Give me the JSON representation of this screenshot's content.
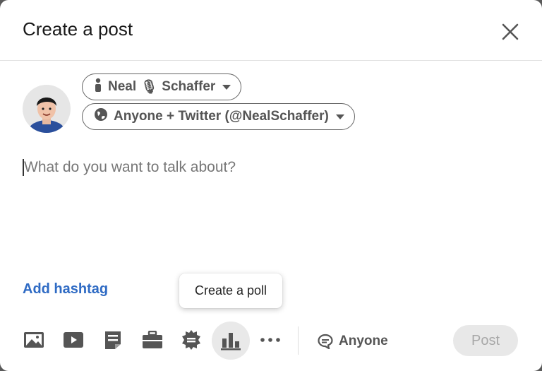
{
  "dialog": {
    "title": "Create a post",
    "close_icon": "close-icon"
  },
  "author": {
    "name_label": "Neal",
    "name_emoji": "🎙",
    "name_label_rest": "Schaffer",
    "visibility_label": "Anyone + Twitter (@NealSchaffer)"
  },
  "editor": {
    "placeholder": "What do you want to talk about?"
  },
  "hashtag_label": "Add hashtag",
  "tooltip": "Create a poll",
  "toolbar": {
    "icons": [
      "photo-icon",
      "video-icon",
      "document-icon",
      "job-icon",
      "celebrate-icon",
      "poll-icon",
      "more-icon"
    ],
    "comment_visibility": "Anyone",
    "post_label": "Post"
  },
  "colors": {
    "link": "#2f6bc4",
    "disabled_button_bg": "#e8e8e8",
    "disabled_button_text": "#a8a8a8"
  }
}
